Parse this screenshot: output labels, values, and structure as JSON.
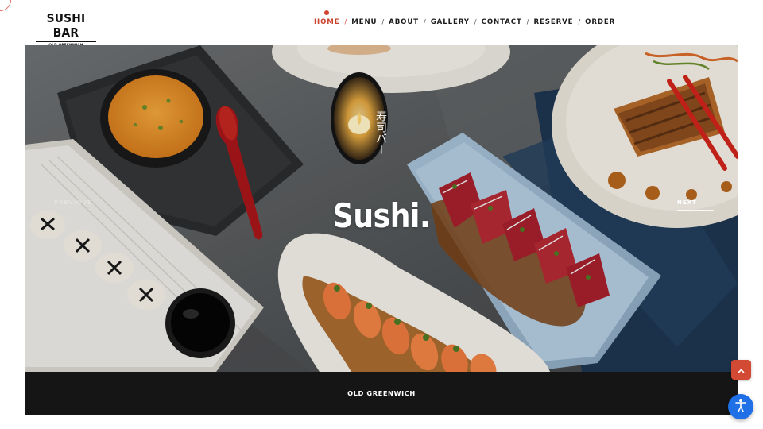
{
  "brand": {
    "name": "SUSHI BAR",
    "location": "OLD GREENWICH"
  },
  "nav": {
    "items": [
      {
        "label": "HOME",
        "active": true
      },
      {
        "label": "MENU",
        "active": false
      },
      {
        "label": "ABOUT",
        "active": false
      },
      {
        "label": "GALLERY",
        "active": false
      },
      {
        "label": "CONTACT",
        "active": false
      },
      {
        "label": "RESERVE",
        "active": false
      },
      {
        "label": "ORDER",
        "active": false
      }
    ],
    "separator": "/"
  },
  "hero": {
    "tagline": "寿司バー",
    "title": "Sushi.",
    "prev_label": "PREVIOUS",
    "next_label": "NEXT",
    "image_icon": "sushi-platter-photo"
  },
  "location_bar": {
    "label": "OLD GREENWICH"
  },
  "floating": {
    "scroll_top_icon": "chevron-up-icon",
    "accessibility_icon": "accessibility-icon"
  },
  "colors": {
    "accent": "#d2452f",
    "location_bar_bg": "#151515",
    "accessibility_blue": "#1f6fe6"
  }
}
